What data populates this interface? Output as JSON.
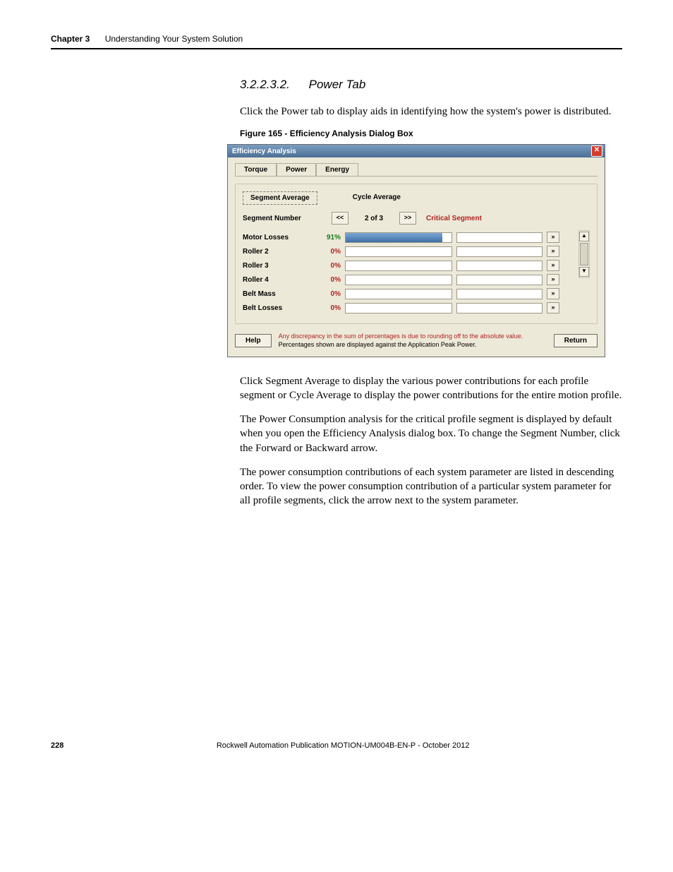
{
  "header": {
    "chapter": "Chapter 3",
    "title": "Understanding Your System Solution"
  },
  "section": {
    "number": "3.2.2.3.2.",
    "title": "Power Tab"
  },
  "paragraphs": {
    "p1": "Click the Power tab to display aids in identifying how the system's power is distributed.",
    "p2": "Click Segment Average to display the various power contributions for each profile segment or Cycle Average to display the power contributions for the entire motion profile.",
    "p3": "The Power Consumption analysis for the critical profile segment is displayed by default when you open the Efficiency Analysis dialog box. To change the Segment Number, click the Forward or Backward arrow.",
    "p4": "The power consumption contributions of each system parameter are listed in descending order. To view the power consumption contribution of a particular system parameter for all profile segments, click the arrow next to the system parameter."
  },
  "figure_caption": "Figure 165 - Efficiency Analysis Dialog Box",
  "dialog": {
    "title": "Efficiency Analysis",
    "close_glyph": "✕",
    "tabs": {
      "torque": "Torque",
      "power": "Power",
      "energy": "Energy"
    },
    "subtabs": {
      "segment_avg": "Segment Average",
      "cycle_avg": "Cycle Average"
    },
    "segment_label": "Segment Number",
    "prev_glyph": "<<",
    "segment_count": "2 of 3",
    "next_glyph": ">>",
    "critical_segment": "Critical Segment",
    "rows": [
      {
        "name": "Motor Losses",
        "pct": "91%",
        "hi": true,
        "fill": 91
      },
      {
        "name": "Roller 2",
        "pct": "0%",
        "hi": false,
        "fill": 0
      },
      {
        "name": "Roller 3",
        "pct": "0%",
        "hi": false,
        "fill": 0
      },
      {
        "name": "Roller 4",
        "pct": "0%",
        "hi": false,
        "fill": 0
      },
      {
        "name": "Belt Mass",
        "pct": "0%",
        "hi": false,
        "fill": 0
      },
      {
        "name": "Belt Losses",
        "pct": "0%",
        "hi": false,
        "fill": 0
      }
    ],
    "arrow_glyph": "»",
    "up_glyph": "▲",
    "down_glyph": "▼",
    "help": "Help",
    "return": "Return",
    "footnote1": "Any discrepancy in the sum of percentages is due to rounding off to the absolute value.",
    "footnote2": "Percentages shown are displayed against the Application Peak Power."
  },
  "footer": {
    "page": "228",
    "pub": "Rockwell Automation Publication MOTION-UM004B-EN-P - October 2012"
  }
}
